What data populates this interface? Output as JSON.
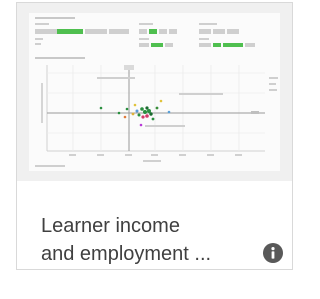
{
  "card": {
    "title_line1": "Learner income",
    "title_line2": "and employment  ...",
    "info_icon": "info-icon",
    "accent_color": "#4fbf4f"
  }
}
